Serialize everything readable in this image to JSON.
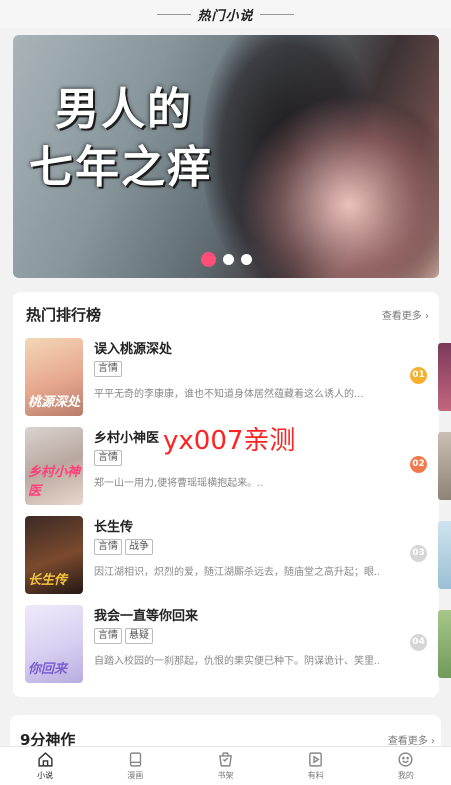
{
  "header": {
    "title": "热门小说"
  },
  "banner": {
    "title_line1": "男人的",
    "title_line2": "七年之痒",
    "slide_count": 3,
    "active_slide": 1
  },
  "hot_ranking": {
    "title": "热门排行榜",
    "more": "查看更多",
    "items": [
      {
        "name": "误入桃源深处",
        "tags": [
          "言情"
        ],
        "desc": "平平无奇的李康康，谁也不知道身体居然蕴藏着这么诱人的...",
        "rank": "01",
        "rank_color": "#f5b02e",
        "cover_text": "桃源深处"
      },
      {
        "name": "乡村小神医",
        "tags": [
          "言情"
        ],
        "desc": "郑一山一用力,便将曹瑶瑶横抱起来。..",
        "rank": "02",
        "rank_color": "#f07a4e",
        "cover_text": "乡村小神医"
      },
      {
        "name": "长生传",
        "tags": [
          "言情",
          "战争"
        ],
        "desc": "因江湖相识，炽烈的爱，随江湖厮杀远去，随庙堂之高升起；眼...",
        "rank": "03",
        "rank_color": "#d6d6d6",
        "cover_text": "长生传"
      },
      {
        "name": "我会一直等你回来",
        "tags": [
          "言情",
          "悬疑"
        ],
        "desc": "自踏入校园的一刹那起，仇恨的果实便已种下。阴谋诡计、笑里...",
        "rank": "04",
        "rank_color": "#d6d6d6",
        "cover_text": "你回来"
      }
    ]
  },
  "watermark": "yx007亲测",
  "nine_points": {
    "title": "9分神作",
    "more": "查看更多"
  },
  "tabbar": [
    {
      "label": "小说",
      "icon": "home-icon",
      "active": true
    },
    {
      "label": "漫画",
      "icon": "book-icon",
      "active": false
    },
    {
      "label": "书架",
      "icon": "bookshelf-icon",
      "active": false
    },
    {
      "label": "有料",
      "icon": "play-icon",
      "active": false
    },
    {
      "label": "我的",
      "icon": "smile-icon",
      "active": false
    }
  ]
}
